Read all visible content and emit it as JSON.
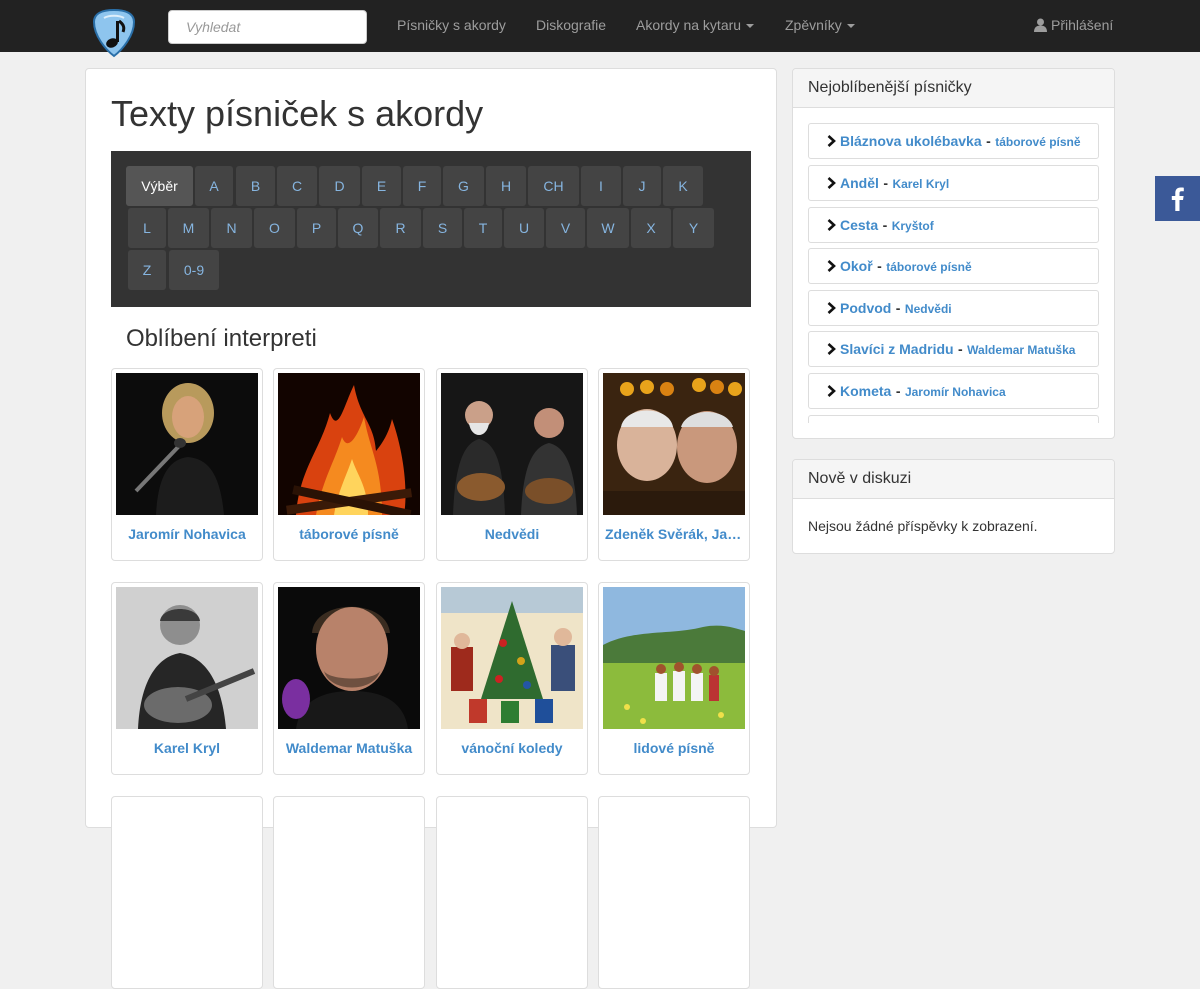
{
  "navbar": {
    "search_placeholder": "Vyhledat",
    "links": [
      {
        "label": "Písničky s akordy",
        "dropdown": false
      },
      {
        "label": "Diskografie",
        "dropdown": false
      },
      {
        "label": "Akordy na kytaru",
        "dropdown": true
      },
      {
        "label": "Zpěvníky",
        "dropdown": true
      }
    ],
    "login_label": "Přihlášení"
  },
  "main": {
    "title": "Texty písniček s akordy",
    "letters": [
      "Výběr",
      "A",
      "B",
      "C",
      "D",
      "E",
      "F",
      "G",
      "H",
      "CH",
      "I",
      "J",
      "K",
      "L",
      "M",
      "N",
      "O",
      "P",
      "Q",
      "R",
      "S",
      "T",
      "U",
      "V",
      "W",
      "X",
      "Y",
      "Z",
      "0-9"
    ],
    "active_letter": "Výběr",
    "favorites_title": "Oblíbení interpreti",
    "artists": [
      {
        "name": "Jaromír Nohavica"
      },
      {
        "name": "táborové písně"
      },
      {
        "name": "Nedvědi"
      },
      {
        "name": "Zdeněk Svěrák, Jaroslav Uhlíř"
      },
      {
        "name": "Karel Kryl"
      },
      {
        "name": "Waldemar Matuška"
      },
      {
        "name": "vánoční koledy"
      },
      {
        "name": "lidové písně"
      }
    ]
  },
  "sidebar": {
    "popular_title": "Nejoblíbenější písničky",
    "popular": [
      {
        "song": "Bláznova ukolébavka",
        "artist": "táborové písně"
      },
      {
        "song": "Anděl",
        "artist": "Karel Kryl"
      },
      {
        "song": "Cesta",
        "artist": "Kryštof"
      },
      {
        "song": "Okoř",
        "artist": "táborové písně"
      },
      {
        "song": "Podvod",
        "artist": "Nedvědi"
      },
      {
        "song": "Slavíci z Madridu",
        "artist": "Waldemar Matuška"
      },
      {
        "song": "Kometa",
        "artist": "Jaromír Nohavica"
      }
    ],
    "separator": "-",
    "discussion_title": "Nově v diskuzi",
    "discussion_empty": "Nejsou žádné příspěvky k zobrazení."
  },
  "colors": {
    "navbar_bg": "#222222",
    "link": "#428bca",
    "facebook": "#3b5998"
  },
  "icons": {
    "logo": "guitar-pick-note-icon",
    "login": "user-icon",
    "list_bullet": "chevron-right-icon",
    "social": "facebook-icon"
  }
}
